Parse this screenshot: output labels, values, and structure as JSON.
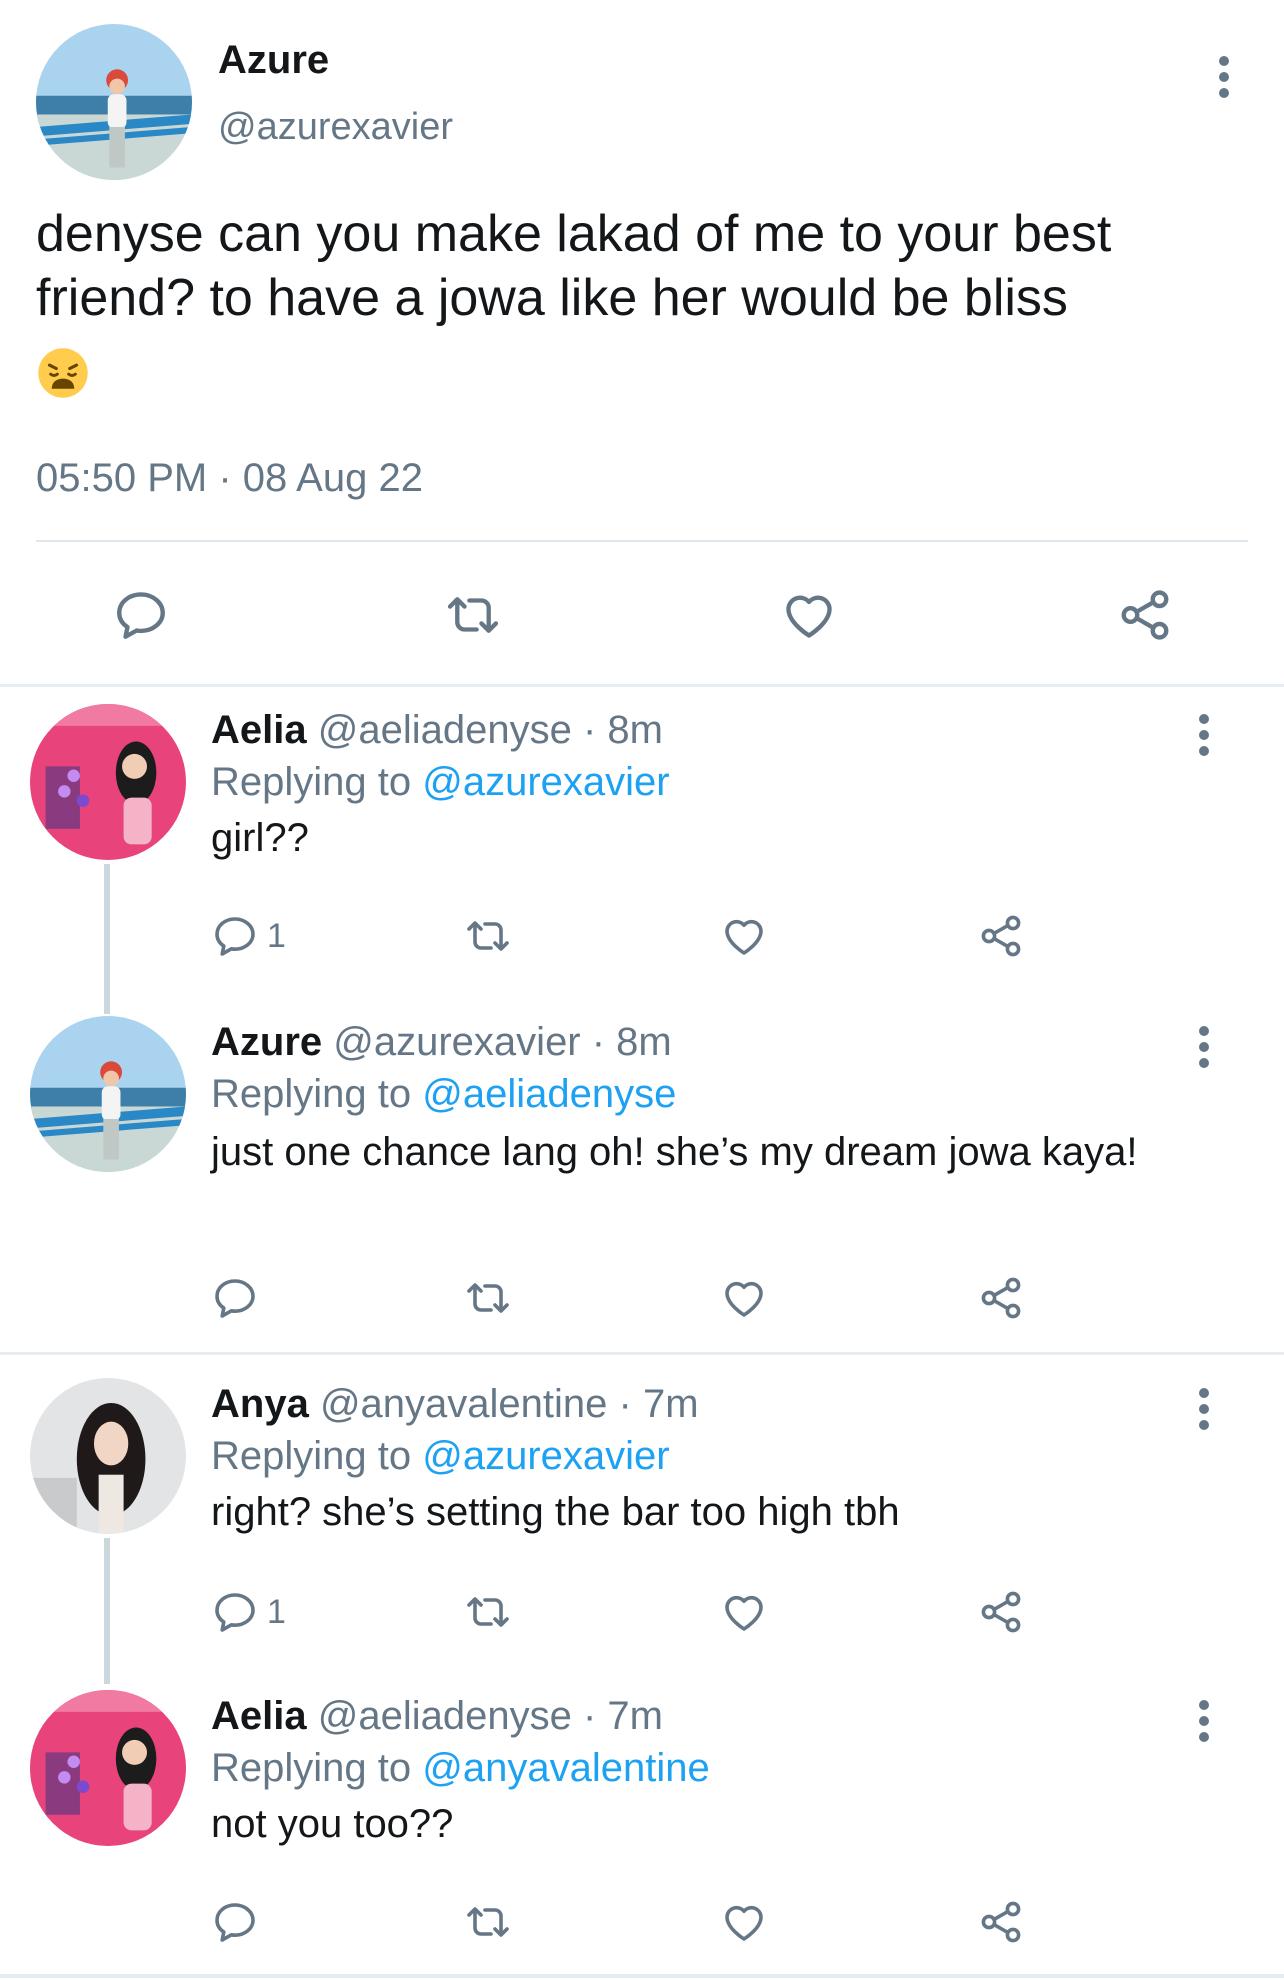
{
  "main_tweet": {
    "name": "Azure",
    "handle": "@azurexavier",
    "text": "denyse can you make lakad of me to your best friend? to have a jowa like her would be bliss",
    "emoji": "weary-face-emoji",
    "timestamp": "05:50 PM · 08 Aug 22"
  },
  "replies": [
    {
      "name": "Aelia",
      "meta": "@aeliadenyse · 8m",
      "replying_prefix": "Replying to",
      "replying_to": "@azurexavier",
      "text": "girl??",
      "reply_count": "1",
      "avatar": "aelia"
    },
    {
      "name": "Azure",
      "meta": "@azurexavier · 8m",
      "replying_prefix": "Replying to",
      "replying_to": "@aeliadenyse",
      "text": "just one chance lang oh! she’s my dream jowa kaya!",
      "reply_count": "",
      "avatar": "azure"
    },
    {
      "name": "Anya",
      "meta": "@anyavalentine · 7m",
      "replying_prefix": "Replying to",
      "replying_to": "@azurexavier",
      "text": "right? she’s setting the bar too high tbh",
      "reply_count": "1",
      "avatar": "anya"
    },
    {
      "name": "Aelia",
      "meta": "@aeliadenyse · 7m",
      "replying_prefix": "Replying to",
      "replying_to": "@anyavalentine",
      "text": "not you too??",
      "reply_count": "",
      "avatar": "aelia"
    }
  ],
  "colors": {
    "accent": "#1da1f2",
    "secondary_text": "#657786",
    "divider": "#e6ecf0",
    "thread_line": "#ccd6dd"
  },
  "icons": [
    "reply-icon",
    "retweet-icon",
    "like-icon",
    "share-icon",
    "more-options-icon"
  ]
}
